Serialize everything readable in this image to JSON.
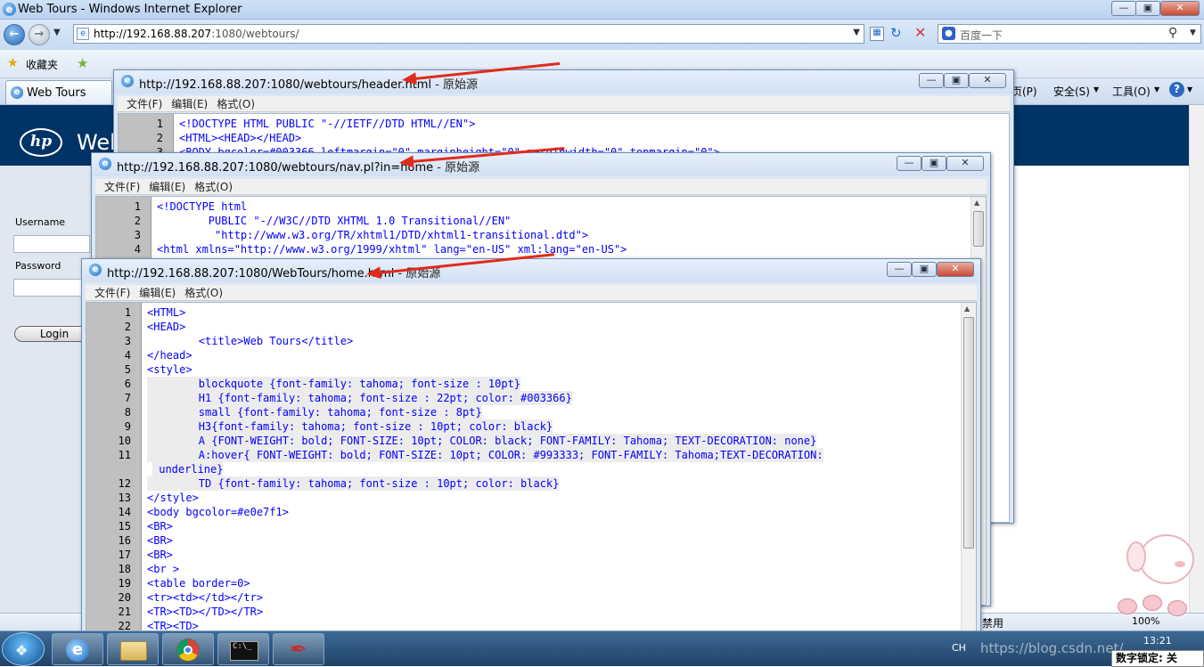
{
  "ie": {
    "window_title": "Web Tours - Windows Internet Explorer",
    "address_url_host": "http://192.168.88.207",
    "address_url_rest": ":1080/webtours/",
    "search_placeholder": "百度一下",
    "favorites_label": "收藏夹",
    "tab_label": "Web Tours",
    "cmd_page": "页(P)",
    "cmd_safety": "安全(S)",
    "cmd_tools": "工具(O)",
    "zoom": "100%",
    "status_protected": "禁用"
  },
  "webtours": {
    "brand": "Web",
    "username_label": "Username",
    "password_label": "Password",
    "login_button": "Login"
  },
  "menus": {
    "file": "文件(F)",
    "edit": "编辑(E)",
    "format": "格式(O)"
  },
  "source_windows": [
    {
      "title": "http://192.168.88.207:1080/webtours/header.html",
      "suffix": " - 原始源",
      "lines": [
        {
          "n": "1",
          "text": "<!DOCTYPE HTML PUBLIC \"-//IETF//DTD HTML//EN\">"
        },
        {
          "n": "2",
          "text": "<HTML><HEAD></HEAD>"
        },
        {
          "n": "3",
          "text": "<BODY bgcolor=#003366 leftmargin=\"0\" marginheight=\"0\" marginwidth=\"0\" topmargin=\"0\">"
        }
      ]
    },
    {
      "title": "http://192.168.88.207:1080/webtours/nav.pl?in=home",
      "suffix": " - 原始源",
      "lines": [
        {
          "n": "1",
          "text": "<!DOCTYPE html"
        },
        {
          "n": "2",
          "text": "        PUBLIC \"-//W3C//DTD XHTML 1.0 Transitional//EN\""
        },
        {
          "n": "3",
          "text": "         \"http://www.w3.org/TR/xhtml1/DTD/xhtml1-transitional.dtd\">"
        },
        {
          "n": "4",
          "text": "<html xmlns=\"http://www.w3.org/1999/xhtml\" lang=\"en-US\" xml:lang=\"en-US\">"
        }
      ]
    },
    {
      "title": "http://192.168.88.207:1080/WebTours/home.html",
      "suffix": " - 原始源",
      "lines": [
        {
          "n": "1",
          "text": "<HTML>"
        },
        {
          "n": "2",
          "text": "<HEAD>"
        },
        {
          "n": "3",
          "text": "        <title>Web Tours</title>"
        },
        {
          "n": "4",
          "text": "</head>"
        },
        {
          "n": "5",
          "text": "<style>"
        },
        {
          "n": "6",
          "text": "        blockquote {font-family: tahoma; font-size : 10pt}"
        },
        {
          "n": "7",
          "text": "        H1 {font-family: tahoma; font-size : 22pt; color: #003366}"
        },
        {
          "n": "8",
          "text": "        small {font-family: tahoma; font-size : 8pt}"
        },
        {
          "n": "9",
          "text": "        H3{font-family: tahoma; font-size : 10pt; color: black}"
        },
        {
          "n": "10",
          "text": "        A {FONT-WEIGHT: bold; FONT-SIZE: 10pt; COLOR: black; FONT-FAMILY: Tahoma; TEXT-DECORATION: none}"
        },
        {
          "n": "11",
          "text": "        A:hover{ FONT-WEIGHT: bold; FONT-SIZE: 10pt; COLOR: #993333; FONT-FAMILY: Tahoma;TEXT-DECORATION:"
        },
        {
          "n": "",
          "text": " underline}"
        },
        {
          "n": "12",
          "text": "        TD {font-family: tahoma; font-size : 10pt; color: black}"
        },
        {
          "n": "13",
          "text": "</style>"
        },
        {
          "n": "14",
          "text": "<body bgcolor=#e0e7f1>"
        },
        {
          "n": "15",
          "text": "<BR>"
        },
        {
          "n": "16",
          "text": "<BR>"
        },
        {
          "n": "17",
          "text": "<BR>"
        },
        {
          "n": "18",
          "text": "<br >"
        },
        {
          "n": "19",
          "text": "<table border=0>"
        },
        {
          "n": "20",
          "text": "<tr><td></td></tr>"
        },
        {
          "n": "21",
          "text": "<TR><TD></TD></TR>"
        },
        {
          "n": "22",
          "text": "<TR><TD>"
        }
      ]
    }
  ],
  "taskbar": {
    "ime": "CH",
    "time": "13:21",
    "numlock": "数字锁定: 关",
    "watermark": "https://blog.csdn.net/"
  }
}
